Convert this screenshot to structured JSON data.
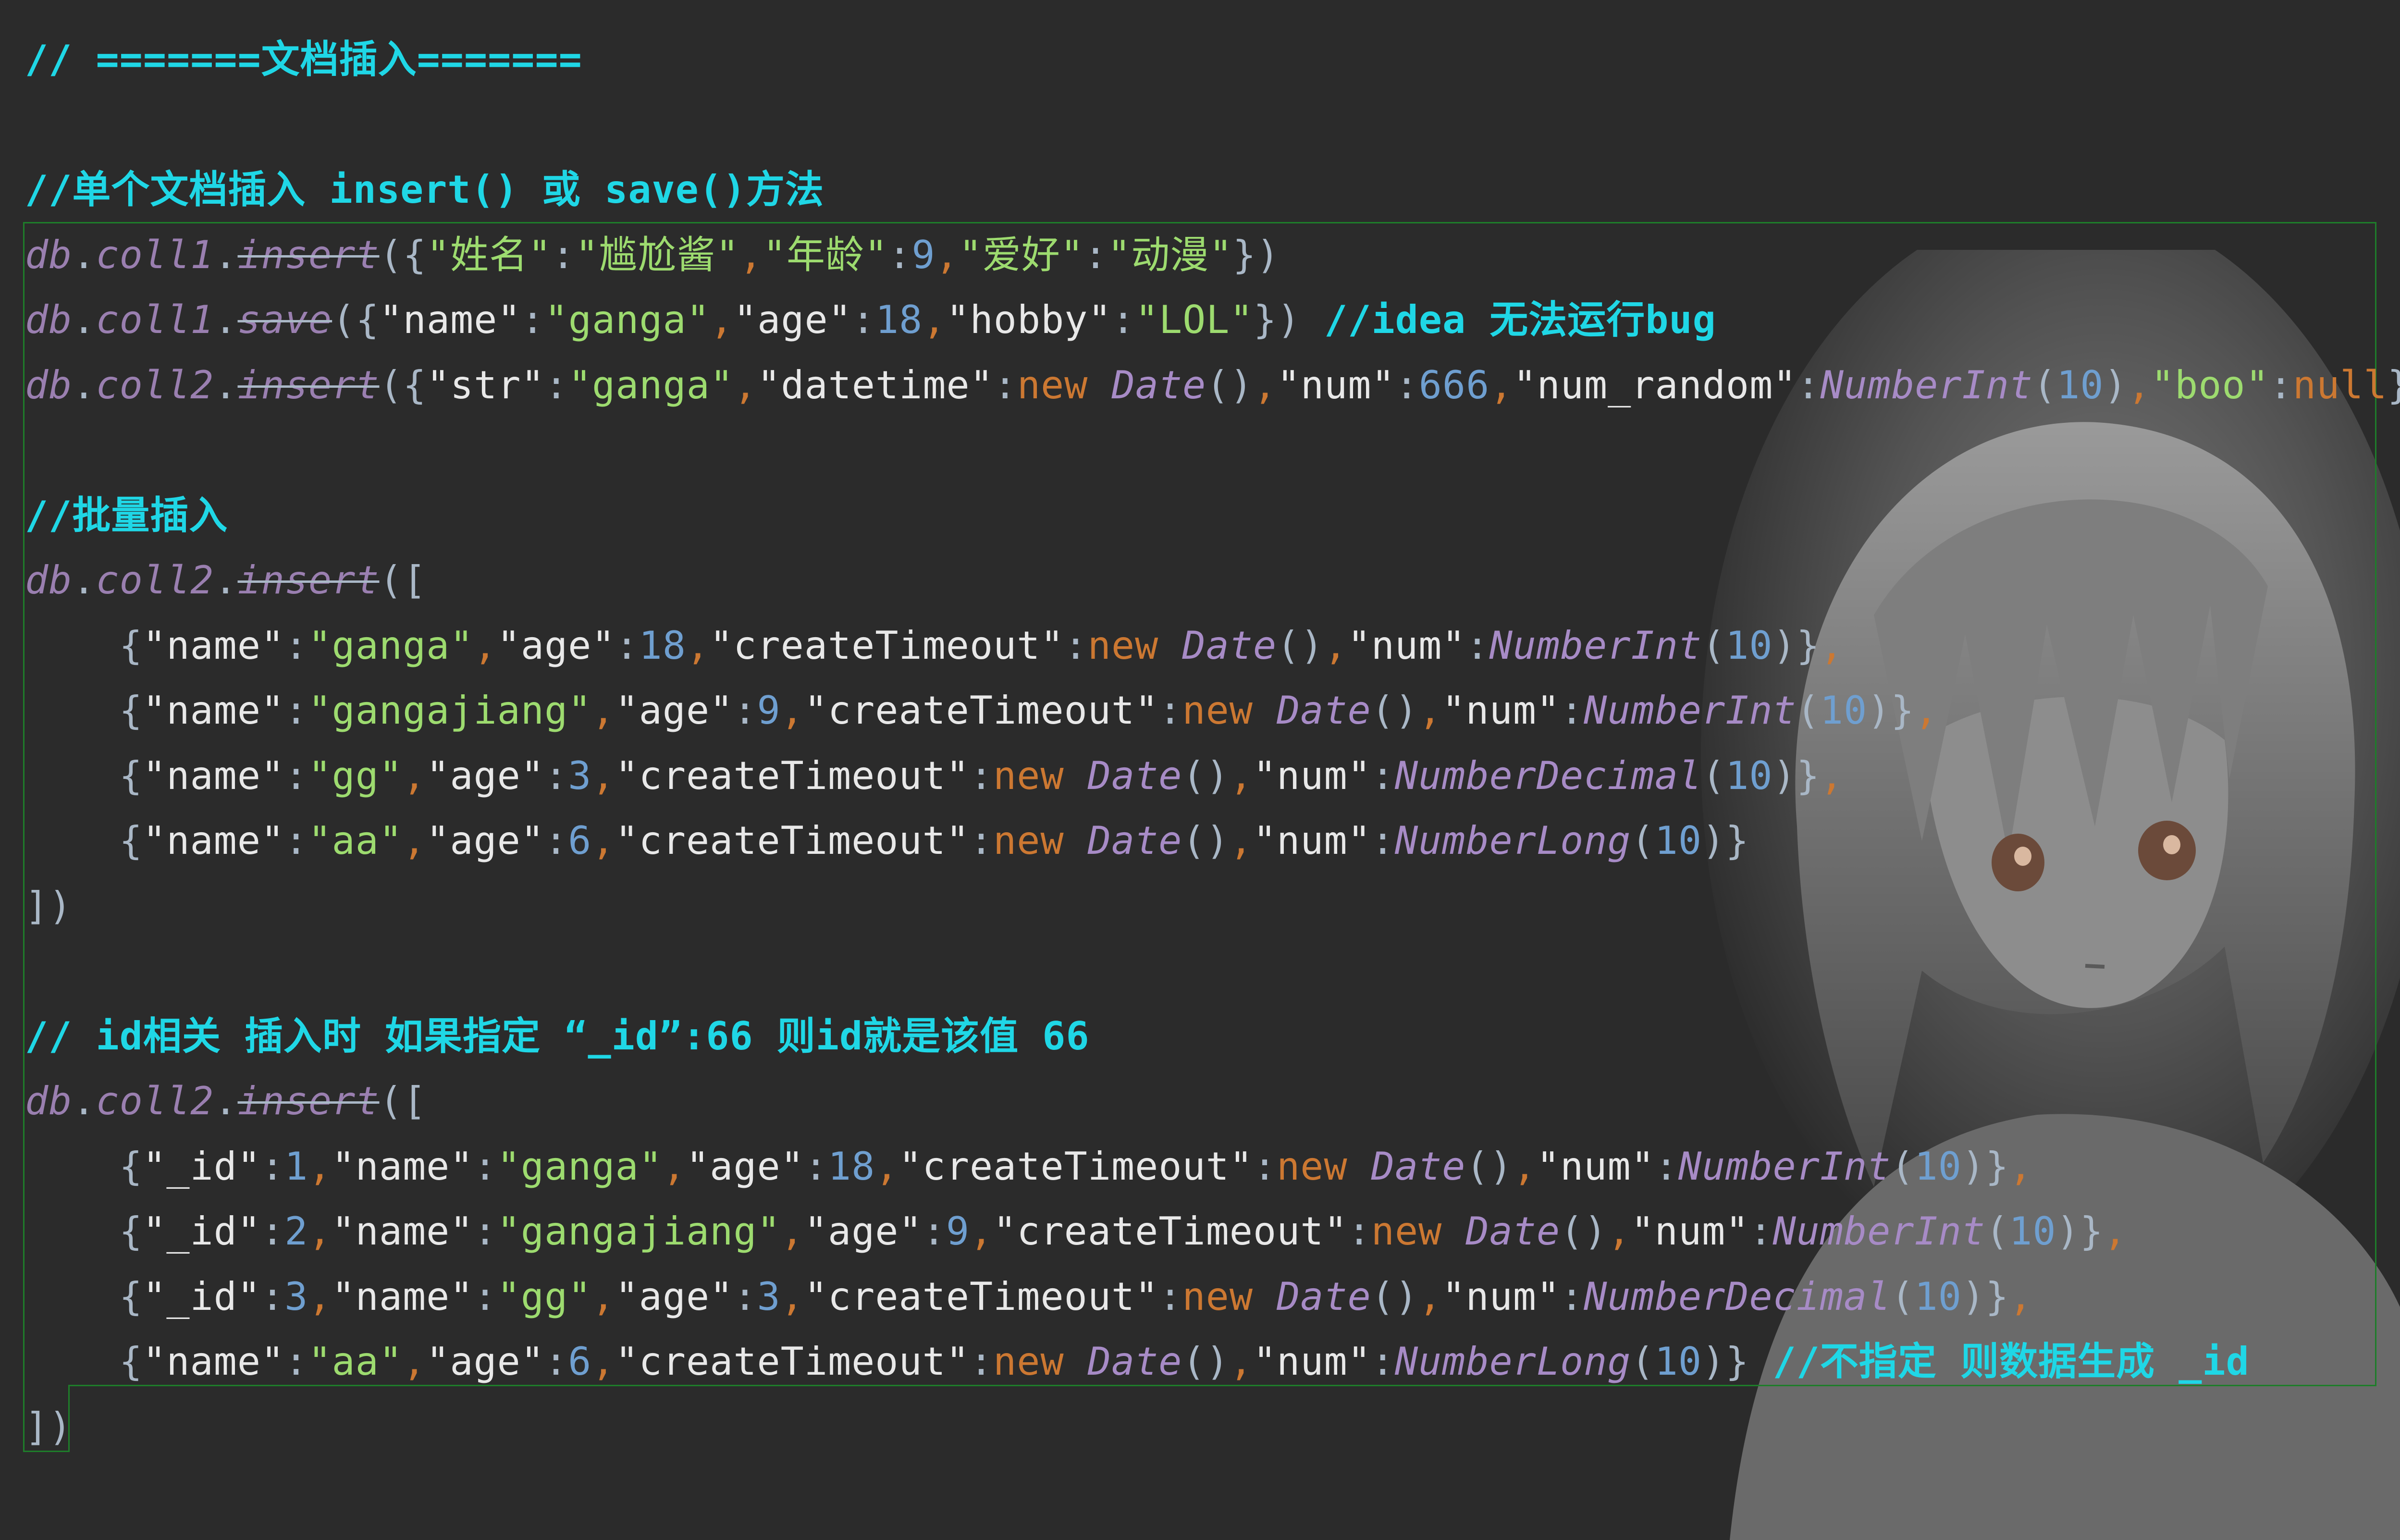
{
  "code_lines": [
    {
      "parts": [
        {
          "t": "// =======文档插入=======",
          "c": "cmt"
        }
      ]
    },
    {
      "parts": []
    },
    {
      "parts": [
        {
          "t": "//单个文档插入 insert() 或 save()方法",
          "c": "cmt"
        }
      ]
    },
    {
      "parts": [
        {
          "t": "db",
          "c": "obj"
        },
        {
          "t": ".",
          "c": "pun"
        },
        {
          "t": "coll1",
          "c": "fld"
        },
        {
          "t": ".",
          "c": "pun"
        },
        {
          "t": "insert",
          "c": "mth"
        },
        {
          "t": "({",
          "c": "pun"
        },
        {
          "t": "\"姓名\"",
          "c": "str"
        },
        {
          "t": ":",
          "c": "pun"
        },
        {
          "t": "\"尴尬酱\"",
          "c": "str"
        },
        {
          "t": ",",
          "c": "com"
        },
        {
          "t": "\"年龄\"",
          "c": "str"
        },
        {
          "t": ":",
          "c": "pun"
        },
        {
          "t": "9",
          "c": "num"
        },
        {
          "t": ",",
          "c": "com"
        },
        {
          "t": "\"爱好\"",
          "c": "str"
        },
        {
          "t": ":",
          "c": "pun"
        },
        {
          "t": "\"动漫\"",
          "c": "str"
        },
        {
          "t": "})",
          "c": "pun"
        }
      ]
    },
    {
      "parts": [
        {
          "t": "db",
          "c": "obj"
        },
        {
          "t": ".",
          "c": "pun"
        },
        {
          "t": "coll1",
          "c": "fld"
        },
        {
          "t": ".",
          "c": "pun"
        },
        {
          "t": "save",
          "c": "mth"
        },
        {
          "t": "({",
          "c": "pun"
        },
        {
          "t": "\"name\"",
          "c": "key"
        },
        {
          "t": ":",
          "c": "pun"
        },
        {
          "t": "\"ganga\"",
          "c": "str"
        },
        {
          "t": ",",
          "c": "com"
        },
        {
          "t": "\"age\"",
          "c": "key"
        },
        {
          "t": ":",
          "c": "pun"
        },
        {
          "t": "18",
          "c": "num"
        },
        {
          "t": ",",
          "c": "com"
        },
        {
          "t": "\"hobby\"",
          "c": "key"
        },
        {
          "t": ":",
          "c": "pun"
        },
        {
          "t": "\"LOL\"",
          "c": "str"
        },
        {
          "t": "}) ",
          "c": "pun"
        },
        {
          "t": "//idea 无法运行bug",
          "c": "cmt"
        }
      ]
    },
    {
      "parts": [
        {
          "t": "db",
          "c": "obj"
        },
        {
          "t": ".",
          "c": "pun"
        },
        {
          "t": "coll2",
          "c": "fld"
        },
        {
          "t": ".",
          "c": "pun"
        },
        {
          "t": "insert",
          "c": "mth"
        },
        {
          "t": "({",
          "c": "pun"
        },
        {
          "t": "\"str\"",
          "c": "key"
        },
        {
          "t": ":",
          "c": "pun"
        },
        {
          "t": "\"ganga\"",
          "c": "str"
        },
        {
          "t": ",",
          "c": "com"
        },
        {
          "t": "\"datetime\"",
          "c": "key"
        },
        {
          "t": ":",
          "c": "pun"
        },
        {
          "t": "new ",
          "c": "kw"
        },
        {
          "t": "Date",
          "c": "cls"
        },
        {
          "t": "()",
          "c": "pun"
        },
        {
          "t": ",",
          "c": "com"
        },
        {
          "t": "\"num\"",
          "c": "key"
        },
        {
          "t": ":",
          "c": "pun"
        },
        {
          "t": "666",
          "c": "num"
        },
        {
          "t": ",",
          "c": "com"
        },
        {
          "t": "\"num_random\"",
          "c": "key"
        },
        {
          "t": ":",
          "c": "pun"
        },
        {
          "t": "NumberInt",
          "c": "cls"
        },
        {
          "t": "(",
          "c": "pun"
        },
        {
          "t": "10",
          "c": "num"
        },
        {
          "t": ")",
          "c": "pun"
        },
        {
          "t": ",",
          "c": "com"
        },
        {
          "t": "\"boo\"",
          "c": "str"
        },
        {
          "t": ":",
          "c": "pun"
        },
        {
          "t": "null",
          "c": "kw"
        },
        {
          "t": "})",
          "c": "pun"
        }
      ]
    },
    {
      "parts": []
    },
    {
      "parts": [
        {
          "t": "//批量插入",
          "c": "cmt"
        }
      ]
    },
    {
      "parts": [
        {
          "t": "db",
          "c": "obj"
        },
        {
          "t": ".",
          "c": "pun"
        },
        {
          "t": "coll2",
          "c": "fld"
        },
        {
          "t": ".",
          "c": "pun"
        },
        {
          "t": "insert",
          "c": "mth"
        },
        {
          "t": "([",
          "c": "pun"
        }
      ]
    },
    {
      "indent": true,
      "parts": [
        {
          "t": "{",
          "c": "pun"
        },
        {
          "t": "\"name\"",
          "c": "key"
        },
        {
          "t": ":",
          "c": "pun"
        },
        {
          "t": "\"ganga\"",
          "c": "str"
        },
        {
          "t": ",",
          "c": "com"
        },
        {
          "t": "\"age\"",
          "c": "key"
        },
        {
          "t": ":",
          "c": "pun"
        },
        {
          "t": "18",
          "c": "num"
        },
        {
          "t": ",",
          "c": "com"
        },
        {
          "t": "\"createTimeout\"",
          "c": "key"
        },
        {
          "t": ":",
          "c": "pun"
        },
        {
          "t": "new ",
          "c": "kw"
        },
        {
          "t": "Date",
          "c": "cls"
        },
        {
          "t": "()",
          "c": "pun"
        },
        {
          "t": ",",
          "c": "com"
        },
        {
          "t": "\"num\"",
          "c": "key"
        },
        {
          "t": ":",
          "c": "pun"
        },
        {
          "t": "NumberInt",
          "c": "cls"
        },
        {
          "t": "(",
          "c": "pun"
        },
        {
          "t": "10",
          "c": "num"
        },
        {
          "t": ")}",
          "c": "pun"
        },
        {
          "t": ",",
          "c": "com"
        }
      ]
    },
    {
      "indent": true,
      "parts": [
        {
          "t": "{",
          "c": "pun"
        },
        {
          "t": "\"name\"",
          "c": "key"
        },
        {
          "t": ":",
          "c": "pun"
        },
        {
          "t": "\"gangajiang\"",
          "c": "str"
        },
        {
          "t": ",",
          "c": "com"
        },
        {
          "t": "\"age\"",
          "c": "key"
        },
        {
          "t": ":",
          "c": "pun"
        },
        {
          "t": "9",
          "c": "num"
        },
        {
          "t": ",",
          "c": "com"
        },
        {
          "t": "\"createTimeout\"",
          "c": "key"
        },
        {
          "t": ":",
          "c": "pun"
        },
        {
          "t": "new ",
          "c": "kw"
        },
        {
          "t": "Date",
          "c": "cls"
        },
        {
          "t": "()",
          "c": "pun"
        },
        {
          "t": ",",
          "c": "com"
        },
        {
          "t": "\"num\"",
          "c": "key"
        },
        {
          "t": ":",
          "c": "pun"
        },
        {
          "t": "NumberInt",
          "c": "cls"
        },
        {
          "t": "(",
          "c": "pun"
        },
        {
          "t": "10",
          "c": "num"
        },
        {
          "t": ")}",
          "c": "pun"
        },
        {
          "t": ",",
          "c": "com"
        }
      ]
    },
    {
      "indent": true,
      "parts": [
        {
          "t": "{",
          "c": "pun"
        },
        {
          "t": "\"name\"",
          "c": "key"
        },
        {
          "t": ":",
          "c": "pun"
        },
        {
          "t": "\"gg\"",
          "c": "str"
        },
        {
          "t": ",",
          "c": "com"
        },
        {
          "t": "\"age\"",
          "c": "key"
        },
        {
          "t": ":",
          "c": "pun"
        },
        {
          "t": "3",
          "c": "num"
        },
        {
          "t": ",",
          "c": "com"
        },
        {
          "t": "\"createTimeout\"",
          "c": "key"
        },
        {
          "t": ":",
          "c": "pun"
        },
        {
          "t": "new ",
          "c": "kw"
        },
        {
          "t": "Date",
          "c": "cls"
        },
        {
          "t": "()",
          "c": "pun"
        },
        {
          "t": ",",
          "c": "com"
        },
        {
          "t": "\"num\"",
          "c": "key"
        },
        {
          "t": ":",
          "c": "pun"
        },
        {
          "t": "NumberDecimal",
          "c": "cls"
        },
        {
          "t": "(",
          "c": "pun"
        },
        {
          "t": "10",
          "c": "num"
        },
        {
          "t": ")}",
          "c": "pun"
        },
        {
          "t": ",",
          "c": "com"
        }
      ]
    },
    {
      "indent": true,
      "parts": [
        {
          "t": "{",
          "c": "pun"
        },
        {
          "t": "\"name\"",
          "c": "key"
        },
        {
          "t": ":",
          "c": "pun"
        },
        {
          "t": "\"aa\"",
          "c": "str"
        },
        {
          "t": ",",
          "c": "com"
        },
        {
          "t": "\"age\"",
          "c": "key"
        },
        {
          "t": ":",
          "c": "pun"
        },
        {
          "t": "6",
          "c": "num"
        },
        {
          "t": ",",
          "c": "com"
        },
        {
          "t": "\"createTimeout\"",
          "c": "key"
        },
        {
          "t": ":",
          "c": "pun"
        },
        {
          "t": "new ",
          "c": "kw"
        },
        {
          "t": "Date",
          "c": "cls"
        },
        {
          "t": "()",
          "c": "pun"
        },
        {
          "t": ",",
          "c": "com"
        },
        {
          "t": "\"num\"",
          "c": "key"
        },
        {
          "t": ":",
          "c": "pun"
        },
        {
          "t": "NumberLong",
          "c": "cls"
        },
        {
          "t": "(",
          "c": "pun"
        },
        {
          "t": "10",
          "c": "num"
        },
        {
          "t": ")}",
          "c": "pun"
        }
      ]
    },
    {
      "parts": [
        {
          "t": "])",
          "c": "pun"
        }
      ]
    },
    {
      "parts": []
    },
    {
      "parts": [
        {
          "t": "// id相关 插入时 如果指定 “_id”:66 则id就是该值 66",
          "c": "cmt"
        }
      ]
    },
    {
      "parts": [
        {
          "t": "db",
          "c": "obj"
        },
        {
          "t": ".",
          "c": "pun"
        },
        {
          "t": "coll2",
          "c": "fld"
        },
        {
          "t": ".",
          "c": "pun"
        },
        {
          "t": "insert",
          "c": "mth"
        },
        {
          "t": "([",
          "c": "pun"
        }
      ]
    },
    {
      "indent": true,
      "parts": [
        {
          "t": "{",
          "c": "pun"
        },
        {
          "t": "\"_id\"",
          "c": "key"
        },
        {
          "t": ":",
          "c": "pun"
        },
        {
          "t": "1",
          "c": "num"
        },
        {
          "t": ",",
          "c": "com"
        },
        {
          "t": "\"name\"",
          "c": "key"
        },
        {
          "t": ":",
          "c": "pun"
        },
        {
          "t": "\"ganga\"",
          "c": "str"
        },
        {
          "t": ",",
          "c": "com"
        },
        {
          "t": "\"age\"",
          "c": "key"
        },
        {
          "t": ":",
          "c": "pun"
        },
        {
          "t": "18",
          "c": "num"
        },
        {
          "t": ",",
          "c": "com"
        },
        {
          "t": "\"createTimeout\"",
          "c": "key"
        },
        {
          "t": ":",
          "c": "pun"
        },
        {
          "t": "new ",
          "c": "kw"
        },
        {
          "t": "Date",
          "c": "cls"
        },
        {
          "t": "()",
          "c": "pun"
        },
        {
          "t": ",",
          "c": "com"
        },
        {
          "t": "\"num\"",
          "c": "key"
        },
        {
          "t": ":",
          "c": "pun"
        },
        {
          "t": "NumberInt",
          "c": "cls"
        },
        {
          "t": "(",
          "c": "pun"
        },
        {
          "t": "10",
          "c": "num"
        },
        {
          "t": ")}",
          "c": "pun"
        },
        {
          "t": ",",
          "c": "com"
        }
      ]
    },
    {
      "indent": true,
      "parts": [
        {
          "t": "{",
          "c": "pun"
        },
        {
          "t": "\"_id\"",
          "c": "key"
        },
        {
          "t": ":",
          "c": "pun"
        },
        {
          "t": "2",
          "c": "num"
        },
        {
          "t": ",",
          "c": "com"
        },
        {
          "t": "\"name\"",
          "c": "key"
        },
        {
          "t": ":",
          "c": "pun"
        },
        {
          "t": "\"gangajiang\"",
          "c": "str"
        },
        {
          "t": ",",
          "c": "com"
        },
        {
          "t": "\"age\"",
          "c": "key"
        },
        {
          "t": ":",
          "c": "pun"
        },
        {
          "t": "9",
          "c": "num"
        },
        {
          "t": ",",
          "c": "com"
        },
        {
          "t": "\"createTimeout\"",
          "c": "key"
        },
        {
          "t": ":",
          "c": "pun"
        },
        {
          "t": "new ",
          "c": "kw"
        },
        {
          "t": "Date",
          "c": "cls"
        },
        {
          "t": "()",
          "c": "pun"
        },
        {
          "t": ",",
          "c": "com"
        },
        {
          "t": "\"num\"",
          "c": "key"
        },
        {
          "t": ":",
          "c": "pun"
        },
        {
          "t": "NumberInt",
          "c": "cls"
        },
        {
          "t": "(",
          "c": "pun"
        },
        {
          "t": "10",
          "c": "num"
        },
        {
          "t": ")}",
          "c": "pun"
        },
        {
          "t": ",",
          "c": "com"
        }
      ]
    },
    {
      "indent": true,
      "parts": [
        {
          "t": "{",
          "c": "pun"
        },
        {
          "t": "\"_id\"",
          "c": "key"
        },
        {
          "t": ":",
          "c": "pun"
        },
        {
          "t": "3",
          "c": "num"
        },
        {
          "t": ",",
          "c": "com"
        },
        {
          "t": "\"name\"",
          "c": "key"
        },
        {
          "t": ":",
          "c": "pun"
        },
        {
          "t": "\"gg\"",
          "c": "str"
        },
        {
          "t": ",",
          "c": "com"
        },
        {
          "t": "\"age\"",
          "c": "key"
        },
        {
          "t": ":",
          "c": "pun"
        },
        {
          "t": "3",
          "c": "num"
        },
        {
          "t": ",",
          "c": "com"
        },
        {
          "t": "\"createTimeout\"",
          "c": "key"
        },
        {
          "t": ":",
          "c": "pun"
        },
        {
          "t": "new ",
          "c": "kw"
        },
        {
          "t": "Date",
          "c": "cls"
        },
        {
          "t": "()",
          "c": "pun"
        },
        {
          "t": ",",
          "c": "com"
        },
        {
          "t": "\"num\"",
          "c": "key"
        },
        {
          "t": ":",
          "c": "pun"
        },
        {
          "t": "NumberDecimal",
          "c": "cls"
        },
        {
          "t": "(",
          "c": "pun"
        },
        {
          "t": "10",
          "c": "num"
        },
        {
          "t": ")}",
          "c": "pun"
        },
        {
          "t": ",",
          "c": "com"
        }
      ]
    },
    {
      "indent": true,
      "parts": [
        {
          "t": "{",
          "c": "pun"
        },
        {
          "t": "\"name\"",
          "c": "key"
        },
        {
          "t": ":",
          "c": "pun"
        },
        {
          "t": "\"aa\"",
          "c": "str"
        },
        {
          "t": ",",
          "c": "com"
        },
        {
          "t": "\"age\"",
          "c": "key"
        },
        {
          "t": ":",
          "c": "pun"
        },
        {
          "t": "6",
          "c": "num"
        },
        {
          "t": ",",
          "c": "com"
        },
        {
          "t": "\"createTimeout\"",
          "c": "key"
        },
        {
          "t": ":",
          "c": "pun"
        },
        {
          "t": "new ",
          "c": "kw"
        },
        {
          "t": "Date",
          "c": "cls"
        },
        {
          "t": "()",
          "c": "pun"
        },
        {
          "t": ",",
          "c": "com"
        },
        {
          "t": "\"num\"",
          "c": "key"
        },
        {
          "t": ":",
          "c": "pun"
        },
        {
          "t": "NumberLong",
          "c": "cls"
        },
        {
          "t": "(",
          "c": "pun"
        },
        {
          "t": "10",
          "c": "num"
        },
        {
          "t": ")} ",
          "c": "pun"
        },
        {
          "t": "//不指定 则数据生成 _id",
          "c": "cmt"
        }
      ]
    },
    {
      "parts": [
        {
          "t": "])",
          "c": "pun"
        }
      ]
    }
  ],
  "colors": {
    "background": "#2b2b2b",
    "comment": "#1fd7e6",
    "string": "#9ddb6f",
    "keyword": "#cc7832",
    "number": "#6f9fd0",
    "class": "#a78bc6",
    "statement_highlight": "#1e7d2a"
  },
  "background_art": {
    "icon": "anime-girl-portrait-art"
  }
}
